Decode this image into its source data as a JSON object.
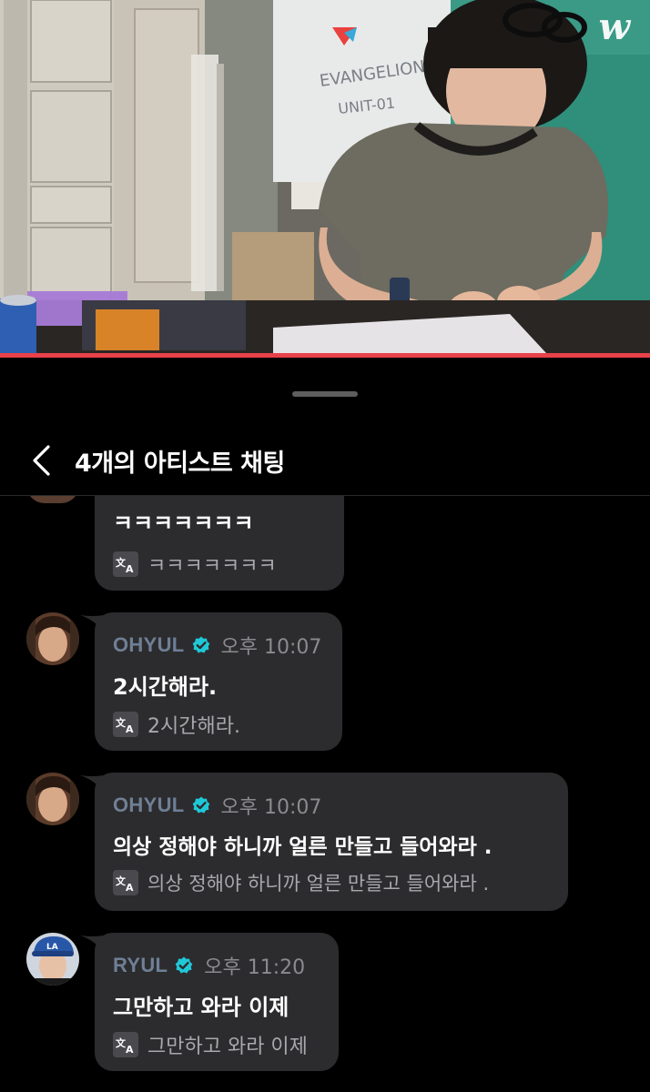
{
  "video": {
    "watermark": "w",
    "progress_fraction": 1.0,
    "accent_color": "#e8414a"
  },
  "header": {
    "title": "4개의 아티스트 채팅",
    "back_icon": "chevron-left-icon"
  },
  "messages": [
    {
      "partial": true,
      "text": "ㅋㅋㅋㅋㅋㅋㅋ",
      "translation": "ㅋㅋㅋㅋㅋㅋㅋ"
    },
    {
      "sender": "OHYUL",
      "verified": true,
      "time": "오후 10:07",
      "text": "2시간해라.",
      "translation": "2시간해라."
    },
    {
      "sender": "OHYUL",
      "verified": true,
      "time": "오후 10:07",
      "text": "의상 정해야 하니까 얼른 만들고 들어와라 .",
      "translation": "의상 정해야 하니까 얼른 만들고 들어와라 ."
    },
    {
      "sender": "RYUL",
      "verified": true,
      "time": "오후 11:20",
      "text": "그만하고 와라 이제",
      "translation": "그만하고 와라 이제"
    }
  ],
  "colors": {
    "background": "#000000",
    "bubble": "#2c2c2e",
    "sender_name": "#6f7f96",
    "verified_badge": "#1fc8d8",
    "translation_text": "#a8a8ad"
  }
}
